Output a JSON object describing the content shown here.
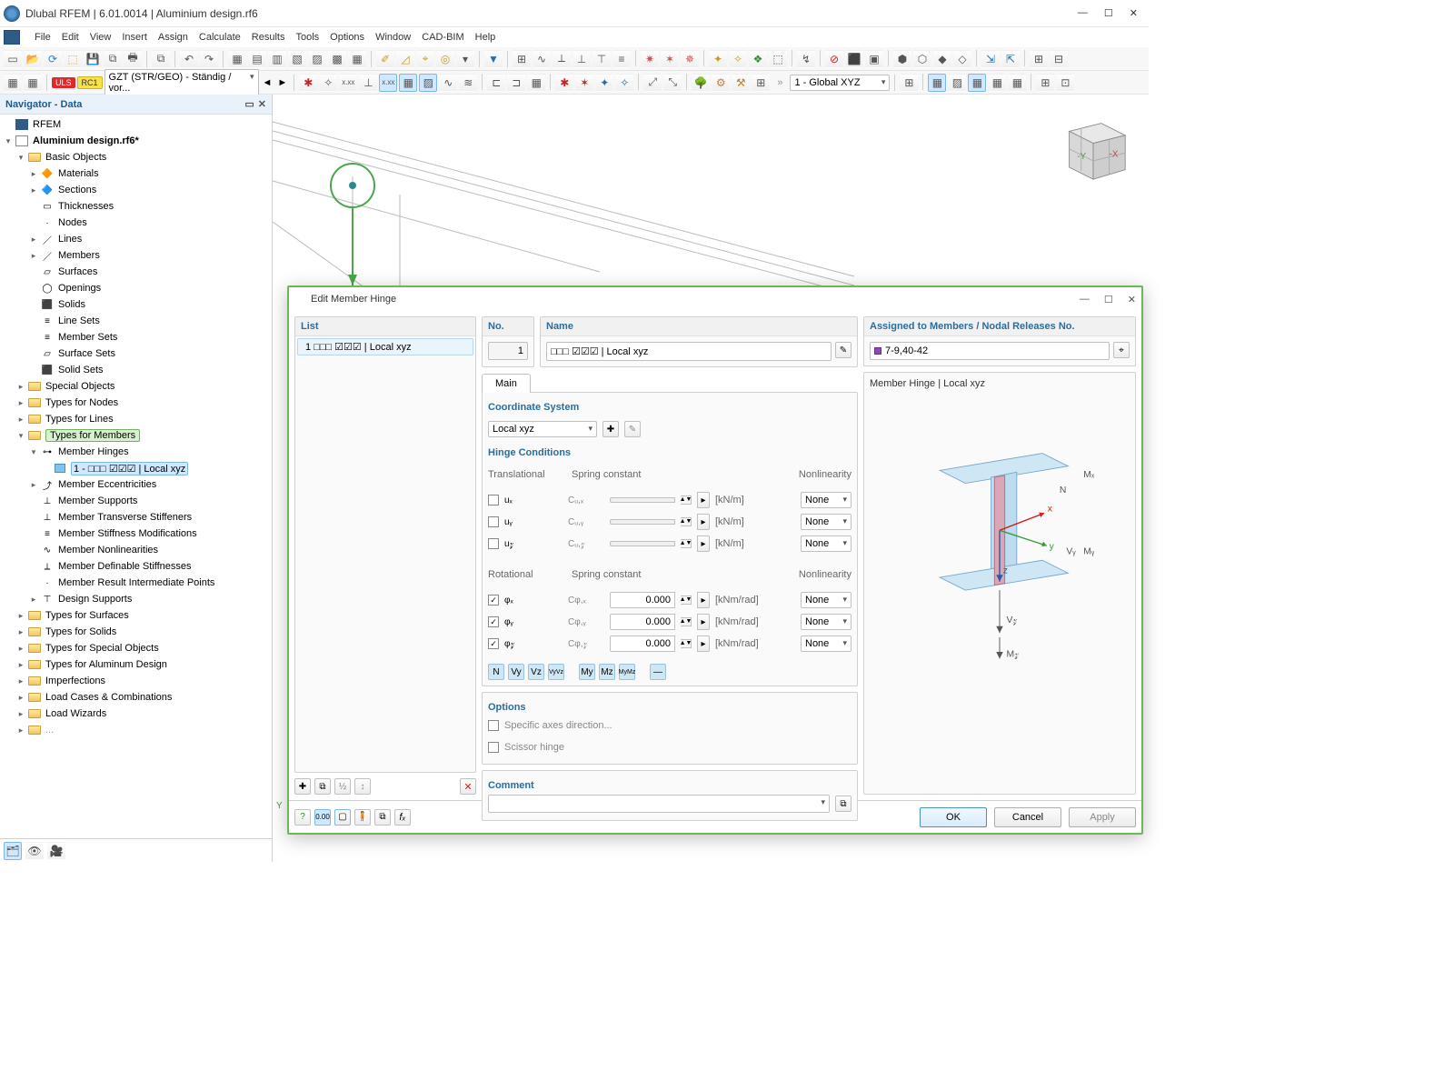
{
  "title": "Dlubal RFEM | 6.01.0014 | Aluminium design.rf6",
  "menus": [
    "File",
    "Edit",
    "View",
    "Insert",
    "Assign",
    "Calculate",
    "Results",
    "Tools",
    "Options",
    "Window",
    "CAD-BIM",
    "Help"
  ],
  "loadcombo": {
    "uls": "ULS",
    "rc": "RC1",
    "combo": "GZT (STR/GEO) - Ständig / vor..."
  },
  "coord_sys_combo": "1 - Global XYZ",
  "navigator": {
    "title": "Navigator - Data",
    "root1": "RFEM",
    "root2": "Aluminium design.rf6*",
    "basic": "Basic Objects",
    "items_basic": [
      "Materials",
      "Sections",
      "Thicknesses",
      "Nodes",
      "Lines",
      "Members",
      "Surfaces",
      "Openings",
      "Solids",
      "Line Sets",
      "Member Sets",
      "Surface Sets",
      "Solid Sets"
    ],
    "items_types": [
      "Special Objects",
      "Types for Nodes",
      "Types for Lines"
    ],
    "types_members": "Types for Members",
    "member_hinges": "Member Hinges",
    "hinge_item": "1 - □□□  ☑☑☑ | Local xyz",
    "member_sub": [
      "Member Eccentricities",
      "Member Supports",
      "Member Transverse Stiffeners",
      "Member Stiffness Modifications",
      "Member Nonlinearities",
      "Member Definable Stiffnesses",
      "Member Result Intermediate Points",
      "Design Supports"
    ],
    "items_after": [
      "Types for Surfaces",
      "Types for Solids",
      "Types for Special Objects",
      "Types for Aluminum Design",
      "Imperfections",
      "Load Cases & Combinations",
      "Load Wizards"
    ]
  },
  "dialog": {
    "title": "Edit Member Hinge",
    "list_header": "List",
    "list_item": "1 □□□  ☑☑☑ | Local xyz",
    "no_header": "No.",
    "no_value": "1",
    "name_header": "Name",
    "name_value": "□□□  ☑☑☑ | Local xyz",
    "assigned_header": "Assigned to Members / Nodal Releases No.",
    "assigned_value": "7-9,40-42",
    "tab_main": "Main",
    "coordsys_header": "Coordinate System",
    "coordsys_value": "Local xyz",
    "hinge_header": "Hinge Conditions",
    "trans_label": "Translational",
    "spring_label": "Spring constant",
    "nonlin_label": "Nonlinearity",
    "rot_label": "Rotational",
    "rows_trans": [
      {
        "sym": "uₓ",
        "c": "Cᵤ,ₓ",
        "unit": "[kN/m]",
        "nl": "None"
      },
      {
        "sym": "uᵧ",
        "c": "Cᵤ,ᵧ",
        "unit": "[kN/m]",
        "nl": "None"
      },
      {
        "sym": "u𝓏",
        "c": "Cᵤ,𝓏",
        "unit": "[kN/m]",
        "nl": "None"
      }
    ],
    "rows_rot": [
      {
        "sym": "φₓ",
        "c": "Cφ,ₓ",
        "val": "0.000",
        "unit": "[kNm/rad]",
        "nl": "None"
      },
      {
        "sym": "φᵧ",
        "c": "Cφ,ᵧ",
        "val": "0.000",
        "unit": "[kNm/rad]",
        "nl": "None"
      },
      {
        "sym": "φ𝓏",
        "c": "Cφ,𝓏",
        "val": "0.000",
        "unit": "[kNm/rad]",
        "nl": "None"
      }
    ],
    "options_header": "Options",
    "opt1": "Specific axes direction...",
    "opt2": "Scissor hinge",
    "comment_header": "Comment",
    "right_header": "Member Hinge | Local xyz",
    "ok": "OK",
    "cancel": "Cancel",
    "apply": "Apply"
  }
}
